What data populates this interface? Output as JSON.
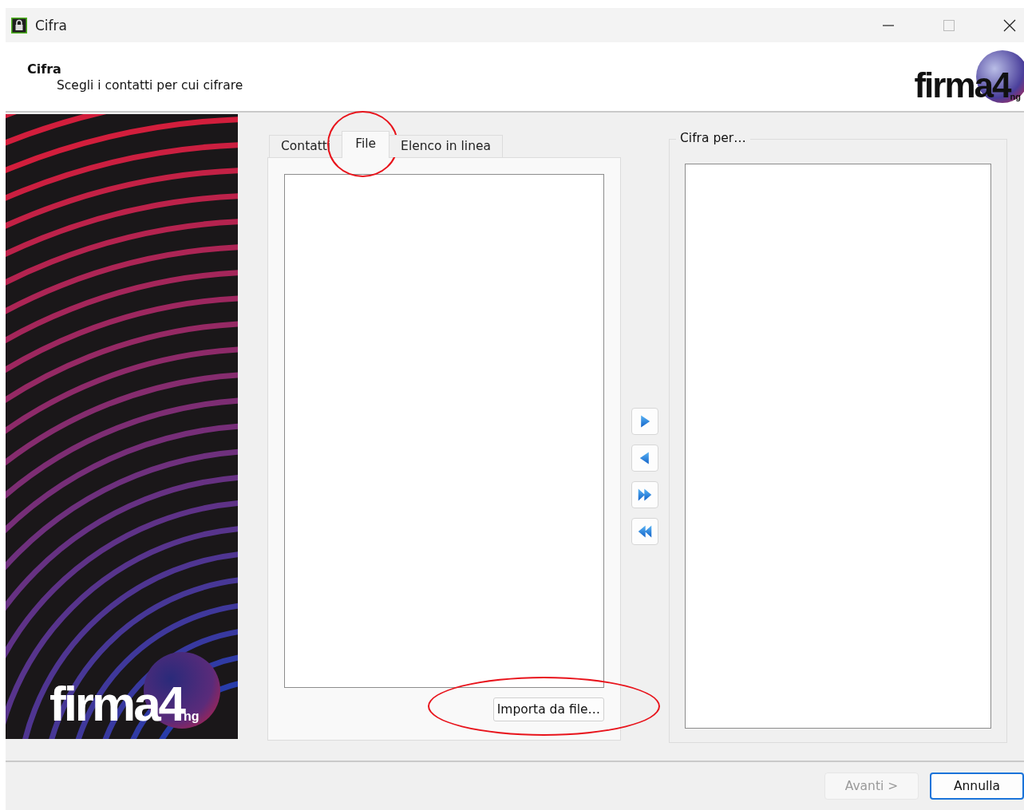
{
  "window": {
    "title": "Cifra"
  },
  "header": {
    "title": "Cifra",
    "subtitle": "Scegli i contatti per cui cifrare",
    "logo": {
      "text": "firma4",
      "suffix": "ng"
    }
  },
  "banner": {
    "logo": {
      "text": "firma4",
      "suffix": "ng"
    }
  },
  "tabs": [
    {
      "label": "Contatti",
      "selected": false,
      "highlighted": false
    },
    {
      "label": "File",
      "selected": true,
      "highlighted": true
    },
    {
      "label": "Elenco in linea",
      "selected": false,
      "highlighted": false
    }
  ],
  "source_panel": {
    "button": {
      "label": "Importa da file…",
      "highlighted": true
    }
  },
  "transfer_buttons": [
    {
      "kind": "add"
    },
    {
      "kind": "remove"
    },
    {
      "kind": "add_all"
    },
    {
      "kind": "remove_all"
    }
  ],
  "target_group": {
    "title": "Cifra per…"
  },
  "footer_buttons": [
    {
      "label": "Avanti >",
      "disabled": true,
      "default": false
    },
    {
      "label": "Annulla",
      "disabled": false,
      "default": true
    }
  ]
}
